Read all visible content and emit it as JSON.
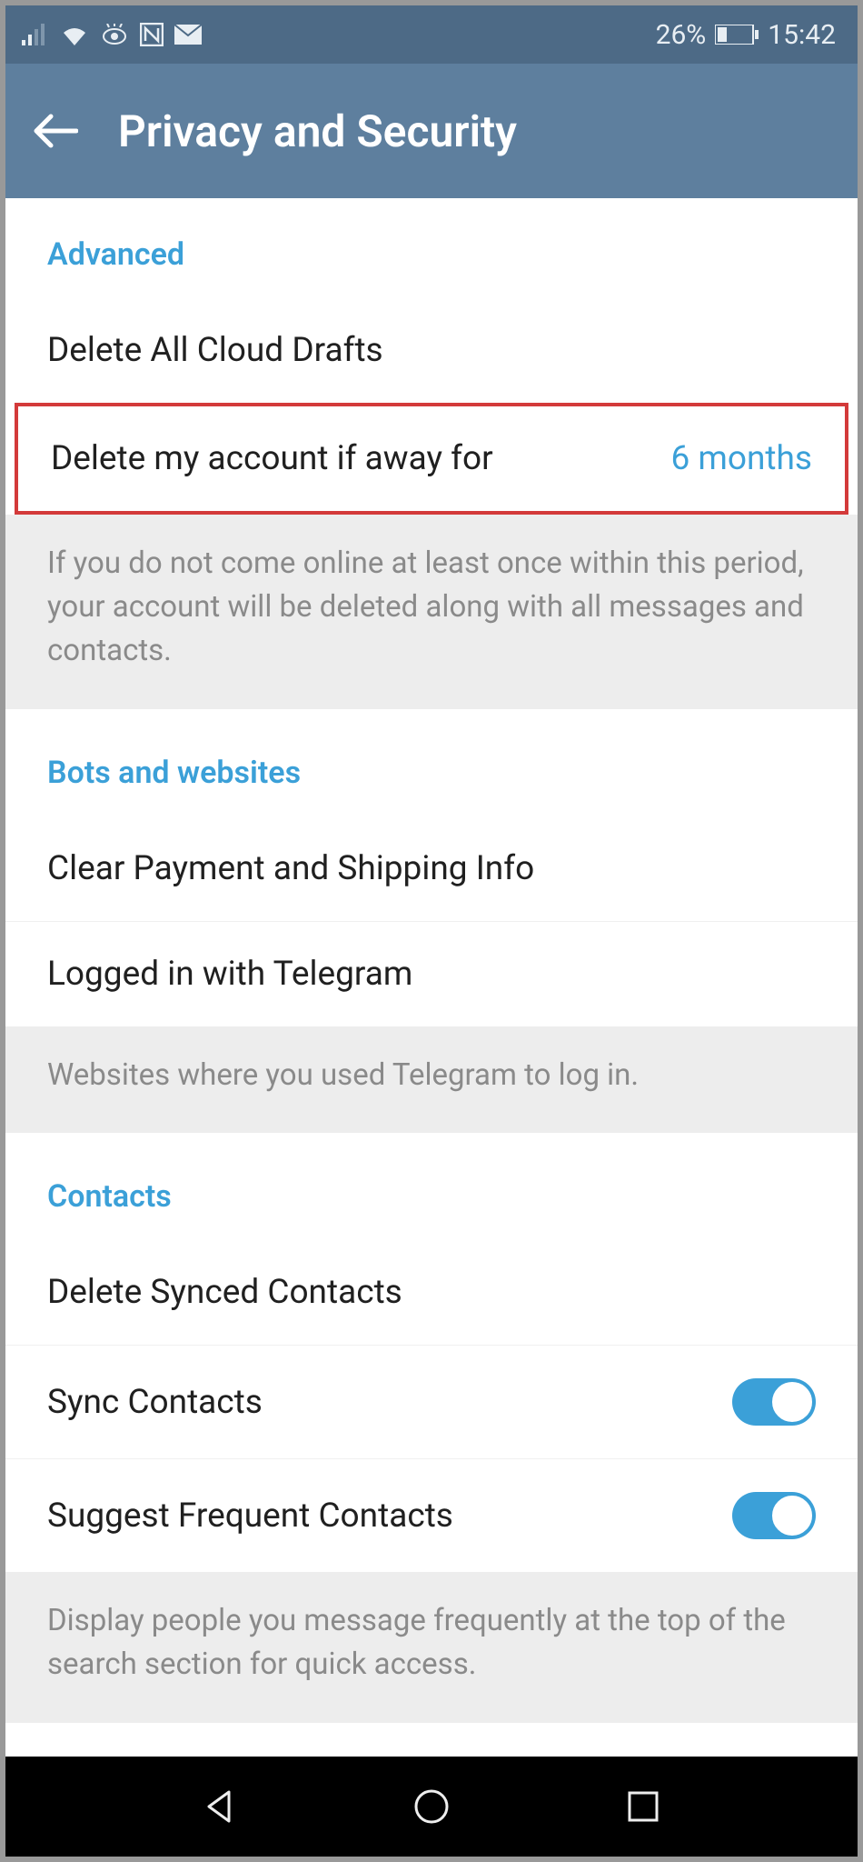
{
  "statusbar": {
    "battery_pct": "26%",
    "time": "15:42"
  },
  "header": {
    "title": "Privacy and Security"
  },
  "sections": {
    "advanced": {
      "title": "Advanced",
      "delete_drafts": "Delete All Cloud Drafts",
      "delete_account_label": "Delete my account if away for",
      "delete_account_value": "6 months",
      "footer": "If you do not come online at least once within this period, your account will be deleted along with all messages and contacts."
    },
    "bots": {
      "title": "Bots and websites",
      "clear_payment": "Clear Payment and Shipping Info",
      "logged_in": "Logged in with Telegram",
      "footer": "Websites where you used Telegram to log in."
    },
    "contacts": {
      "title": "Contacts",
      "delete_synced": "Delete Synced Contacts",
      "sync": "Sync Contacts",
      "suggest": "Suggest Frequent Contacts",
      "footer": "Display people you message frequently at the top of the search section for quick access."
    }
  }
}
